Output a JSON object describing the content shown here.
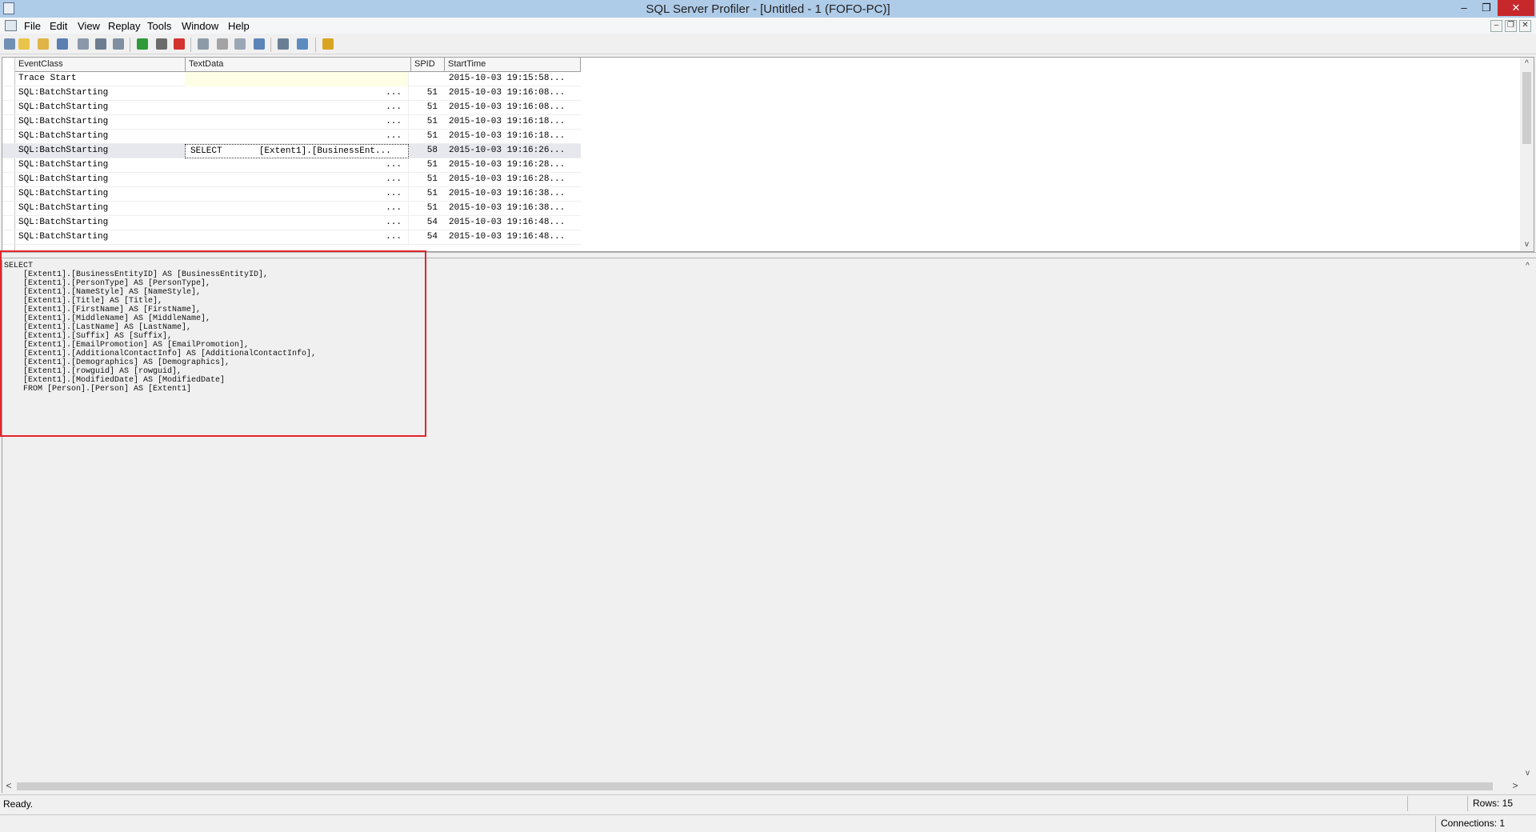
{
  "window": {
    "title": "SQL Server Profiler - [Untitled - 1 (FOFO-PC)]",
    "minimize_glyph": "–",
    "restore_glyph": "❐",
    "close_glyph": "✕"
  },
  "menu": {
    "items": [
      "File",
      "Edit",
      "View",
      "Replay",
      "Tools",
      "Window",
      "Help"
    ],
    "mdi_buttons": [
      "–",
      "❐",
      "✕"
    ]
  },
  "toolbar": {
    "buttons": [
      {
        "icon": "new-trace-icon",
        "color": "#6f8fb4"
      },
      {
        "icon": "new-template-icon",
        "color": "#e9c44a"
      },
      {
        "icon": "open-icon",
        "color": "#e0b446"
      },
      {
        "icon": "save-icon",
        "color": "#5a7fb0"
      },
      {
        "icon": "properties-icon",
        "color": "#8a99aa"
      },
      {
        "icon": "find-icon",
        "color": "#6d7d8f"
      },
      {
        "icon": "clear-trace-icon",
        "color": "#7f8f9f"
      },
      {
        "icon": "run-trace-icon",
        "color": "#2e9a3a"
      },
      {
        "icon": "pause-trace-icon",
        "color": "#6b6b6b"
      },
      {
        "icon": "stop-trace-icon",
        "color": "#d4322f"
      },
      {
        "icon": "trace-properties-icon",
        "color": "#8d9ba9"
      },
      {
        "icon": "clear-window-icon",
        "color": "#a3a3a3"
      },
      {
        "icon": "column-icon",
        "color": "#9aa7b4"
      },
      {
        "icon": "auto-scroll-icon",
        "color": "#5b84b8"
      },
      {
        "icon": "activity-monitor-icon",
        "color": "#6a7f96"
      },
      {
        "icon": "perfmon-icon",
        "color": "#5c8bbf"
      },
      {
        "icon": "help-icon",
        "color": "#d9a520"
      }
    ]
  },
  "grid": {
    "columns": [
      "EventClass",
      "TextData",
      "SPID",
      "StartTime"
    ],
    "rows": [
      {
        "event": "Trace Start",
        "text": "",
        "spid": "",
        "start": "2015-10-03 19:15:58..."
      },
      {
        "event": "SQL:BatchStarting",
        "text": "...",
        "spid": "51",
        "start": "2015-10-03 19:16:08..."
      },
      {
        "event": "SQL:BatchStarting",
        "text": "...",
        "spid": "51",
        "start": "2015-10-03 19:16:08..."
      },
      {
        "event": "SQL:BatchStarting",
        "text": "...",
        "spid": "51",
        "start": "2015-10-03 19:16:18..."
      },
      {
        "event": "SQL:BatchStarting",
        "text": "...",
        "spid": "51",
        "start": "2015-10-03 19:16:18..."
      },
      {
        "event": "SQL:BatchStarting",
        "text": "SELECT       [Extent1].[BusinessEnt...",
        "spid": "58",
        "start": "2015-10-03 19:16:26...",
        "selected": true
      },
      {
        "event": "SQL:BatchStarting",
        "text": "...",
        "spid": "51",
        "start": "2015-10-03 19:16:28..."
      },
      {
        "event": "SQL:BatchStarting",
        "text": "...",
        "spid": "51",
        "start": "2015-10-03 19:16:28..."
      },
      {
        "event": "SQL:BatchStarting",
        "text": "...",
        "spid": "51",
        "start": "2015-10-03 19:16:38..."
      },
      {
        "event": "SQL:BatchStarting",
        "text": "...",
        "spid": "51",
        "start": "2015-10-03 19:16:38..."
      },
      {
        "event": "SQL:BatchStarting",
        "text": "...",
        "spid": "54",
        "start": "2015-10-03 19:16:48..."
      },
      {
        "event": "SQL:BatchStarting",
        "text": "...",
        "spid": "54",
        "start": "2015-10-03 19:16:48..."
      }
    ]
  },
  "detail": {
    "sql": "SELECT \n    [Extent1].[BusinessEntityID] AS [BusinessEntityID], \n    [Extent1].[PersonType] AS [PersonType], \n    [Extent1].[NameStyle] AS [NameStyle], \n    [Extent1].[Title] AS [Title], \n    [Extent1].[FirstName] AS [FirstName], \n    [Extent1].[MiddleName] AS [MiddleName], \n    [Extent1].[LastName] AS [LastName], \n    [Extent1].[Suffix] AS [Suffix], \n    [Extent1].[EmailPromotion] AS [EmailPromotion], \n    [Extent1].[AdditionalContactInfo] AS [AdditionalContactInfo], \n    [Extent1].[Demographics] AS [Demographics], \n    [Extent1].[rowguid] AS [rowguid], \n    [Extent1].[ModifiedDate] AS [ModifiedDate]\n    FROM [Person].[Person] AS [Extent1]",
    "highlight_color": "#e0262b"
  },
  "status": {
    "ready": "Ready.",
    "rows": "Rows: 15",
    "connections": "Connections: 1"
  },
  "scroll": {
    "up": "^",
    "down": "v",
    "left": "<",
    "right": ">"
  }
}
